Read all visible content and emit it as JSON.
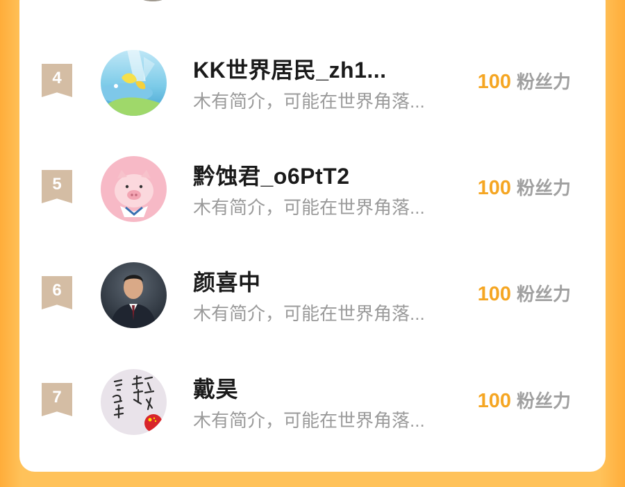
{
  "ranking": {
    "items": [
      {
        "rank": "4",
        "name": "KK世界居民_zh1...",
        "bio": "木有简介，可能在世界角落...",
        "score": "100",
        "score_unit": "粉丝力",
        "avatar_icon": "landscape-avatar"
      },
      {
        "rank": "5",
        "name": "黔蚀君_o6PtT2",
        "bio": "木有简介，可能在世界角落...",
        "score": "100",
        "score_unit": "粉丝力",
        "avatar_icon": "pig-avatar"
      },
      {
        "rank": "6",
        "name": "颜喜中",
        "bio": "木有简介，可能在世界角落...",
        "score": "100",
        "score_unit": "粉丝力",
        "avatar_icon": "portrait-avatar"
      },
      {
        "rank": "7",
        "name": "戴昊",
        "bio": "木有简介，可能在世界角落...",
        "score": "100",
        "score_unit": "粉丝力",
        "avatar_icon": "calligraphy-avatar"
      }
    ]
  },
  "colors": {
    "background": "#ffc25a",
    "card": "#ffffff",
    "rank_badge": "#d4bda4",
    "score": "#f5a623",
    "unit": "#a0a0a0",
    "name": "#1a1a1a",
    "bio": "#9a9a9a"
  }
}
